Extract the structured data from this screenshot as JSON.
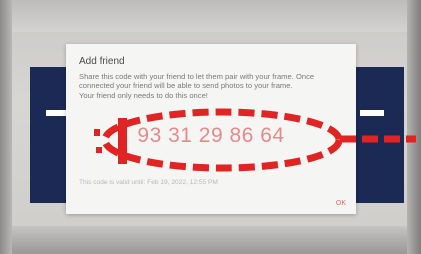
{
  "dialog": {
    "title": "Add friend",
    "body_line1": "Share this code with your friend to let them pair with your frame. Once",
    "body_line2": "connected your friend will be able to send photos to your frame.",
    "body_line3": "Your friend only needs to do this once!",
    "code": "93 31 29 86 64",
    "valid_until": "This code is valid until: Feb 19, 2022, 12:55 PM",
    "ok_label": "OK"
  },
  "colors": {
    "accent": "#e36a6a",
    "annotation": "#e02323",
    "screen_background": "#1b2a55"
  }
}
